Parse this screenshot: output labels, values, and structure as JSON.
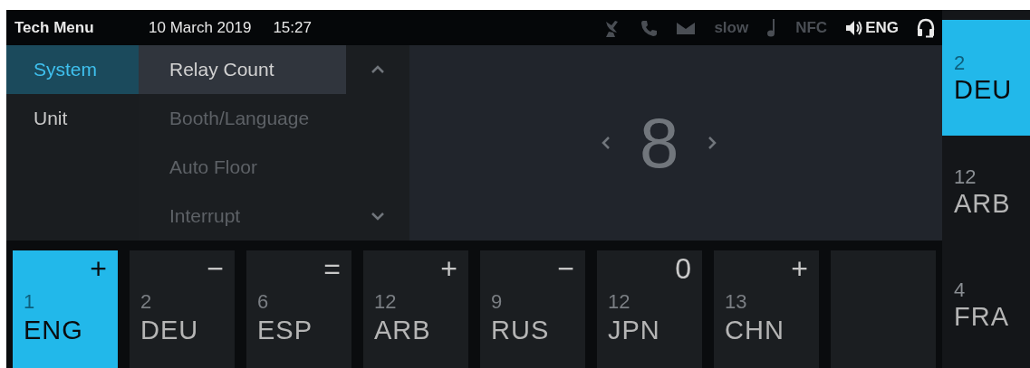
{
  "top_bar": {
    "title": "Tech Menu",
    "date": "10 March 2019",
    "time": "15:27",
    "status": [
      {
        "kind": "dish",
        "active": false
      },
      {
        "kind": "phone",
        "active": false
      },
      {
        "kind": "mail",
        "active": false
      },
      {
        "kind": "text",
        "label": "slow",
        "active": false
      },
      {
        "kind": "note",
        "active": false
      },
      {
        "kind": "text",
        "label": "NFC",
        "active": false
      },
      {
        "kind": "audio",
        "label": "ENG",
        "active": true
      },
      {
        "kind": "headset",
        "active": true
      }
    ]
  },
  "sidebar": {
    "items": [
      {
        "label": "System",
        "selected": true
      },
      {
        "label": "Unit",
        "selected": false
      }
    ]
  },
  "submenu": {
    "items": [
      {
        "label": "Relay Count",
        "selected": true
      },
      {
        "label": "Booth/Language",
        "selected": false
      },
      {
        "label": "Auto Floor",
        "selected": false
      },
      {
        "label": "Interrupt",
        "selected": false
      }
    ]
  },
  "value": "8",
  "channels": [
    {
      "kind": "channel",
      "sign": "+",
      "number": "1",
      "code": "ENG",
      "selected": true
    },
    {
      "kind": "channel",
      "sign": "−",
      "number": "2",
      "code": "DEU",
      "selected": false
    },
    {
      "kind": "channel",
      "sign": "=",
      "number": "6",
      "code": "ESP",
      "selected": false
    },
    {
      "kind": "channel",
      "sign": "+",
      "number": "12",
      "code": "ARB",
      "selected": false
    },
    {
      "kind": "channel",
      "sign": "−",
      "number": "9",
      "code": "RUS",
      "selected": false
    },
    {
      "kind": "channel",
      "sign": "0",
      "number": "12",
      "code": "JPN",
      "selected": false
    },
    {
      "kind": "channel",
      "sign": "+",
      "number": "13",
      "code": "CHN",
      "selected": false
    },
    {
      "kind": "empty",
      "selected": false
    }
  ],
  "side_channels": [
    {
      "number": "2",
      "code": "DEU",
      "selected": true
    },
    {
      "number": "12",
      "code": "ARB",
      "selected": false
    },
    {
      "number": "4",
      "code": "FRA",
      "selected": false
    }
  ]
}
